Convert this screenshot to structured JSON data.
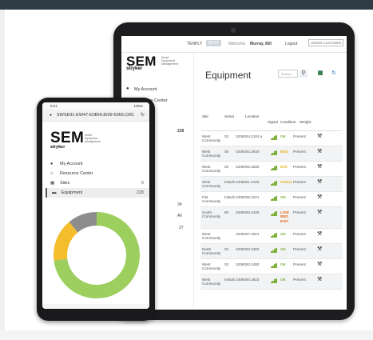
{
  "tablet": {
    "header": {
      "env_label": "TENPLY",
      "env_tag": "BETA",
      "welcome": "Welcome,",
      "user": "Murray, Bill",
      "logout": "Logout",
      "custom": "ORDER CUSTOMER"
    },
    "logo": {
      "brand": "SEM",
      "tagline": "Smart Equipment Management",
      "sub": "stryker"
    },
    "nav": [
      {
        "icon": "user-icon",
        "label": "My Account",
        "count": ""
      },
      {
        "icon": "home-icon",
        "label": "Resource Center",
        "count": ""
      },
      {
        "icon": "grid-icon",
        "label": "Sites",
        "count": "5"
      },
      {
        "icon": "bed-icon",
        "label": "Equipment",
        "count": "228"
      }
    ],
    "title": "Equipment",
    "search_placeholder": "Search",
    "table": {
      "headers": [
        "Site",
        "Serial",
        "Location",
        "Signal",
        "Condition",
        "Weight"
      ],
      "rows": [
        {
          "site": "West Community",
          "serial": "02",
          "loc": "1006004.2104.a",
          "cond": "OK",
          "cond_class": "",
          "wt": "Present"
        },
        {
          "site": "West Community",
          "serial": "05",
          "loc": "1006002.2830",
          "cond": "BED",
          "cond_class": "warn",
          "wt": "Present"
        },
        {
          "site": "West Community",
          "serial": "03",
          "loc": "1006002.2830",
          "cond": "Exit",
          "cond_class": "warn",
          "wt": "Present"
        },
        {
          "site": "West Community",
          "serial": "InBuilt",
          "loc": "1006001.2105",
          "cond": "Partial",
          "cond_class": "warn",
          "wt": "Present"
        },
        {
          "site": "Fist Community",
          "serial": "InBuilt",
          "loc": "1006006.2221",
          "cond": "OK",
          "cond_class": "",
          "wt": "Present"
        },
        {
          "site": "South Community",
          "serial": "90",
          "loc": "1006006.2426",
          "cond": "LOW BED EXIT",
          "cond_class": "bad",
          "wt": "Present"
        },
        {
          "site": "West Community",
          "serial": "",
          "loc": "1006007.2001",
          "cond": "OK",
          "cond_class": "",
          "wt": "Present"
        },
        {
          "site": "North Community",
          "serial": "02",
          "loc": "1006003.2460",
          "cond": "OK",
          "cond_class": "",
          "wt": "Present"
        },
        {
          "site": "West Community",
          "serial": "03",
          "loc": "1006000.2480",
          "cond": "OK",
          "cond_class": "",
          "wt": "Present"
        },
        {
          "site": "West Community",
          "serial": "InBuilt",
          "loc": "1006000.2823",
          "cond": "OK",
          "cond_class": "",
          "wt": "Present"
        }
      ]
    },
    "peek": {
      "a": "228",
      "b": "34",
      "c": "All",
      "d": "27"
    }
  },
  "phone": {
    "status": {
      "time": "9:41",
      "battery": "100%"
    },
    "url": "SWSE91-EW47-E0BHLB/09-5066.CM1",
    "logo": {
      "brand": "SEM",
      "tagline": "Smart Equipment Management",
      "sub": "stryker"
    },
    "nav": [
      {
        "icon": "user-icon",
        "label": "My Account",
        "count": ""
      },
      {
        "icon": "home-icon",
        "label": "Resource Center",
        "count": ""
      },
      {
        "icon": "grid-icon",
        "label": "Sites",
        "count": "5"
      },
      {
        "icon": "bed-icon",
        "label": "Equipment",
        "count": "228"
      }
    ],
    "donut": {
      "segments": [
        {
          "name": "green",
          "fraction": 0.73,
          "color": "#9dcf5e"
        },
        {
          "name": "yellow",
          "fraction": 0.16,
          "color": "#f3bd2c"
        },
        {
          "name": "gray",
          "fraction": 0.11,
          "color": "#8d8d8d"
        }
      ]
    }
  },
  "colors": {
    "accent_green": "#7fb23d",
    "warning": "#e6b31e",
    "alert": "#e66a17",
    "device": "#1d1d1f"
  }
}
